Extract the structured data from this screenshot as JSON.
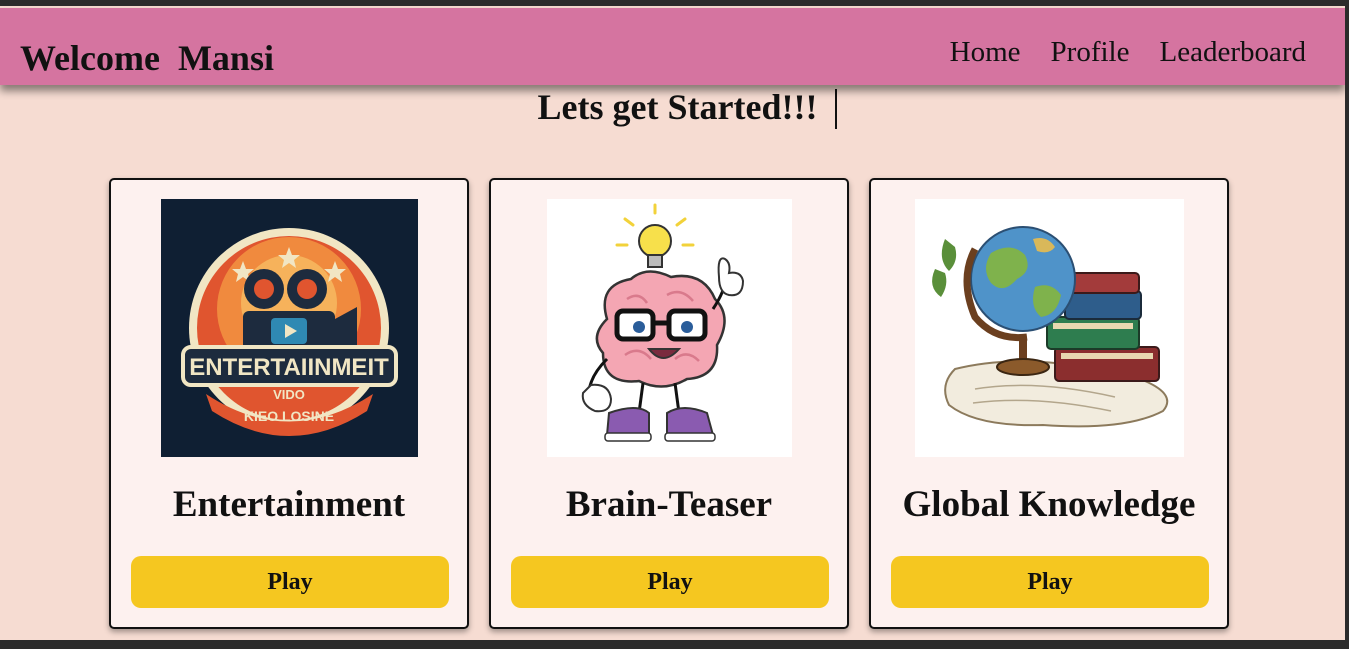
{
  "navbar": {
    "brand": "Welcome  Mansi",
    "links": [
      "Home",
      "Profile",
      "Leaderboard"
    ]
  },
  "main": {
    "heading": "Lets get Started!!!"
  },
  "cards": [
    {
      "title": "Entertainment",
      "play_label": "Play",
      "image": {
        "icon": "film-camera-badge-icon",
        "line1": "ENTERTAIINMEIT",
        "line2": "VIDO",
        "line3": "KIEO LOSINE"
      }
    },
    {
      "title": "Brain-Teaser",
      "play_label": "Play",
      "image": {
        "icon": "cartoon-brain-lightbulb-icon"
      }
    },
    {
      "title": "Global Knowledge",
      "play_label": "Play",
      "image": {
        "icon": "globe-books-icon"
      }
    }
  ],
  "colors": {
    "page_bg": "#f6dcd2",
    "navbar_bg": "#d574a0",
    "card_bg": "#fdf1ef",
    "button_bg": "#f5c720"
  }
}
